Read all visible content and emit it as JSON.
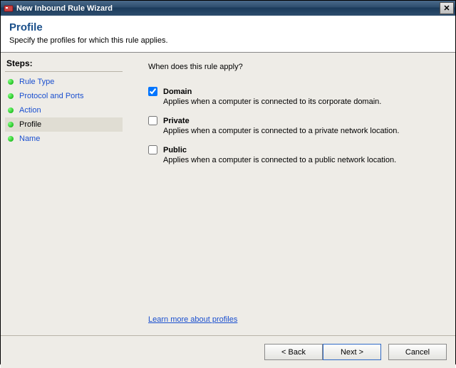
{
  "window": {
    "title": "New Inbound Rule Wizard"
  },
  "header": {
    "title": "Profile",
    "subtitle": "Specify the profiles for which this rule applies."
  },
  "sidebar": {
    "title": "Steps:",
    "items": [
      {
        "label": "Rule Type"
      },
      {
        "label": "Protocol and Ports"
      },
      {
        "label": "Action"
      },
      {
        "label": "Profile"
      },
      {
        "label": "Name"
      }
    ],
    "current_index": 3
  },
  "content": {
    "prompt": "When does this rule apply?",
    "options": [
      {
        "name": "Domain",
        "desc": "Applies when a computer is connected to its corporate domain.",
        "checked": true
      },
      {
        "name": "Private",
        "desc": "Applies when a computer is connected to a private network location.",
        "checked": false
      },
      {
        "name": "Public",
        "desc": "Applies when a computer is connected to a public network location.",
        "checked": false
      }
    ],
    "learn_link": "Learn more about profiles"
  },
  "footer": {
    "back": "< Back",
    "next": "Next >",
    "cancel": "Cancel"
  }
}
